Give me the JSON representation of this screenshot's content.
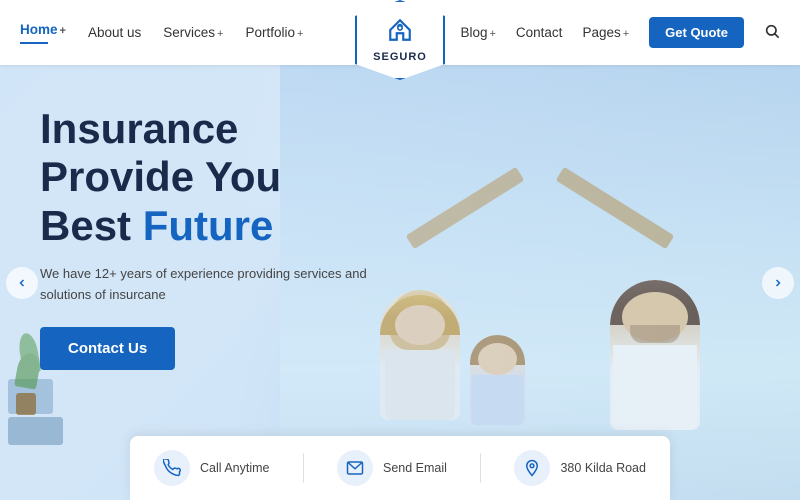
{
  "navbar": {
    "logo_text": "SEGURO",
    "nav_items": [
      {
        "label": "Home",
        "plus": "+",
        "active": true
      },
      {
        "label": "About us",
        "plus": "",
        "active": false
      },
      {
        "label": "Services",
        "plus": "+",
        "active": false
      },
      {
        "label": "Portfolio",
        "plus": "+",
        "active": false
      },
      {
        "label": "Blog",
        "plus": "+",
        "active": false
      },
      {
        "label": "Contact",
        "plus": "",
        "active": false
      },
      {
        "label": "Pages",
        "plus": "+",
        "active": false
      }
    ],
    "quote_btn": "Get Quote"
  },
  "hero": {
    "title_line1": "Insurance",
    "title_line2": "Provide You",
    "title_line3_plain": "Best ",
    "title_line3_highlight": "Future",
    "subtitle": "We have 12+ years of experience providing services and solutions of insurcane",
    "cta_button": "Contact Us"
  },
  "info_bar": {
    "items": [
      {
        "icon": "📞",
        "label": "Call Anytime"
      },
      {
        "icon": "✉",
        "label": "Send Email"
      },
      {
        "icon": "📍",
        "label": "380 Kilda Road"
      }
    ]
  }
}
